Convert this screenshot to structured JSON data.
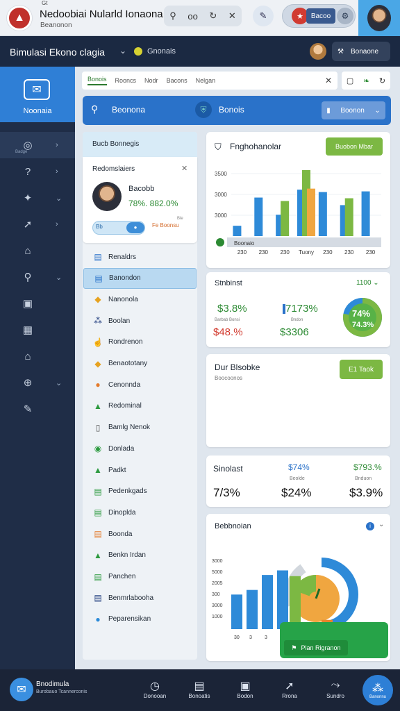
{
  "browser": {
    "tiny_label": "Gt",
    "site_title": "Nedoobiai Nularld Ionaona",
    "site_subtitle": "Beanonon",
    "toolbar_text": "oo",
    "pill_text": "Bacoo"
  },
  "header": {
    "app_title": "Bimulasi Ekono clagia",
    "status": "Gnonais",
    "button_label": "Bonaone"
  },
  "sidebar": {
    "brand_label": "Noonaia",
    "items": [
      {
        "icon": "gauge-icon",
        "glyph": "◎",
        "sub": "Badge",
        "chev": "›",
        "active": true
      },
      {
        "icon": "question-icon",
        "glyph": "?",
        "sub": "",
        "chev": "›",
        "active": false
      },
      {
        "icon": "puzzle-icon",
        "glyph": "✦",
        "sub": "",
        "chev": "⌄",
        "active": false
      },
      {
        "icon": "rocket-icon",
        "glyph": "➚",
        "sub": "",
        "chev": "›",
        "active": false
      },
      {
        "icon": "building-icon",
        "glyph": "⌂",
        "sub": "",
        "chev": "",
        "active": false
      },
      {
        "icon": "search-icon",
        "glyph": "⚲",
        "sub": "",
        "chev": "⌄",
        "active": false
      },
      {
        "icon": "monitor-icon",
        "glyph": "▣",
        "sub": "",
        "chev": "",
        "active": false
      },
      {
        "icon": "table-icon",
        "glyph": "▦",
        "sub": "",
        "chev": "",
        "active": false
      },
      {
        "icon": "bank-icon",
        "glyph": "⌂",
        "sub": "",
        "chev": "",
        "active": false
      },
      {
        "icon": "globe-icon",
        "glyph": "⊕",
        "sub": "",
        "chev": "⌄",
        "active": false
      },
      {
        "icon": "pen-icon",
        "glyph": "✎",
        "sub": "",
        "chev": "",
        "active": false
      }
    ]
  },
  "tabs": [
    "Bonois",
    "Rooncs",
    "Nodr",
    "Bacons",
    "Nelgan"
  ],
  "banner": {
    "text1": "Beonona",
    "text2": "Bonois",
    "button": "Boonon"
  },
  "leftcol": {
    "header": "Bucb Bonnegis",
    "profile": {
      "title": "Redomslaiers",
      "name": "Bacobb",
      "value": "78%. 882.0%",
      "toggle_label": "Bb",
      "tag": "Fe Boonsu",
      "tag_small": "Ble"
    },
    "menu": [
      {
        "label": "Renaldrs",
        "glyph": "▤",
        "color": "#2a72c9",
        "sel": false
      },
      {
        "label": "Banondon",
        "glyph": "▤",
        "color": "#2a72c9",
        "sel": true
      },
      {
        "label": "Nanonola",
        "glyph": "◆",
        "color": "#e6a21f",
        "sel": false
      },
      {
        "label": "Boolan",
        "glyph": "⁂",
        "color": "#1d3a7c",
        "sel": false
      },
      {
        "label": "Rondrenon",
        "glyph": "☝",
        "color": "#555",
        "sel": false
      },
      {
        "label": "Benaototany",
        "glyph": "◆",
        "color": "#e6a21f",
        "sel": false
      },
      {
        "label": "Cenonnda",
        "glyph": "●",
        "color": "#e47a2b",
        "sel": false
      },
      {
        "label": "Redominal",
        "glyph": "▲",
        "color": "#2c9a3f",
        "sel": false
      },
      {
        "label": "Bamlg Nenok",
        "glyph": "▯",
        "color": "#555",
        "sel": false
      },
      {
        "label": "Donlada",
        "glyph": "◉",
        "color": "#2c9a3f",
        "sel": false
      },
      {
        "label": "Padkt",
        "glyph": "▲",
        "color": "#2c9a3f",
        "sel": false
      },
      {
        "label": "Pedenkgads",
        "glyph": "▤",
        "color": "#2c9a3f",
        "sel": false
      },
      {
        "label": "Dinoplda",
        "glyph": "▤",
        "color": "#2c9a3f",
        "sel": false
      },
      {
        "label": "Boonda",
        "glyph": "▤",
        "color": "#e47a2b",
        "sel": false
      },
      {
        "label": "Benkn Irdan",
        "glyph": "▲",
        "color": "#2c9a3f",
        "sel": false
      },
      {
        "label": "Panchen",
        "glyph": "▤",
        "color": "#2c9a3f",
        "sel": false
      },
      {
        "label": "Benmrlabooha",
        "glyph": "▤",
        "color": "#1d3a7c",
        "sel": false
      },
      {
        "label": "Peparensikan",
        "glyph": "●",
        "color": "#2a8ad8",
        "sel": false
      }
    ]
  },
  "card1": {
    "title": "Fnghohanolar",
    "button": "Buobon Mbar",
    "legend": "Boonaio"
  },
  "chart_data": [
    {
      "type": "bar",
      "categories": [
        "230",
        "230",
        "230",
        "Tuony",
        "230",
        "230",
        "230"
      ],
      "series": [
        {
          "values": [
            300,
            1120,
            620,
            1350,
            1280,
            900,
            1300
          ]
        },
        {
          "values": [
            0,
            0,
            1020,
            1920,
            0,
            1100,
            0
          ]
        },
        {
          "values": [
            0,
            0,
            0,
            1380,
            0,
            0,
            0
          ]
        }
      ],
      "y_ticks": [
        "3500",
        "3000",
        "3000"
      ],
      "ylim": [
        0,
        2100
      ],
      "colors": [
        "#2e8ad8",
        "#7cb843",
        "#f0a640"
      ]
    },
    {
      "type": "bar",
      "categories": [
        "",
        "",
        "",
        "",
        "",
        ""
      ],
      "series": [
        {
          "values": [
            600,
            680,
            940,
            1020,
            0,
            0
          ]
        },
        {
          "values": [
            0,
            0,
            0,
            0,
            920,
            0
          ]
        },
        {
          "values": [
            0,
            0,
            0,
            0,
            0,
            160
          ]
        }
      ],
      "y_ticks": [
        "3000",
        "5000",
        "2005",
        "300",
        "3000",
        "1000"
      ],
      "ylim": [
        0,
        1400
      ],
      "colors": [
        "#2e8ad8",
        "#7cb843",
        "#e9842b"
      ]
    }
  ],
  "card2": {
    "title": "Stnbinst",
    "right": "1100",
    "v1": "$3.8%",
    "l1": "Barbab Bonsi",
    "v2": "$48.%",
    "v3": "7173%",
    "l3": "Bndon",
    "v4": "$3306",
    "gauge_v1": "74%",
    "gauge_v2": "74.3%",
    "gauge_fraction": 0.78
  },
  "card3": {
    "title": "Dur Blsobke",
    "subtitle": "Boocoonos",
    "button": "E1 Taok"
  },
  "card4": {
    "c1_top": "Sinolast",
    "c1_bot": "7/3%",
    "c2_top": "$74%",
    "c2_label": "Beolde",
    "c2_bot": "$24%",
    "c3_top": "$793.%",
    "c3_label": "Bnduon",
    "c3_bot": "$3.9%"
  },
  "card5": {
    "title": "Bebbnoian",
    "green_label": "Plan Rigranon",
    "x_ticks": [
      "30",
      "3",
      "3",
      "3"
    ]
  },
  "bottombar": {
    "app_name": "Bnodimula",
    "app_sub": "Burobauo Tcannerconis",
    "nav": [
      {
        "icon": "clock-icon",
        "glyph": "◷",
        "label": "Donooan"
      },
      {
        "icon": "calendar-icon",
        "glyph": "▤",
        "label": "Bonoatis"
      },
      {
        "icon": "image-icon",
        "glyph": "▣",
        "label": "Bodon"
      },
      {
        "icon": "rocket-icon",
        "glyph": "➚",
        "label": "Rrona"
      },
      {
        "icon": "route-icon",
        "glyph": "⤳",
        "label": "Sundro"
      }
    ],
    "fab_label": "Banonnu"
  }
}
